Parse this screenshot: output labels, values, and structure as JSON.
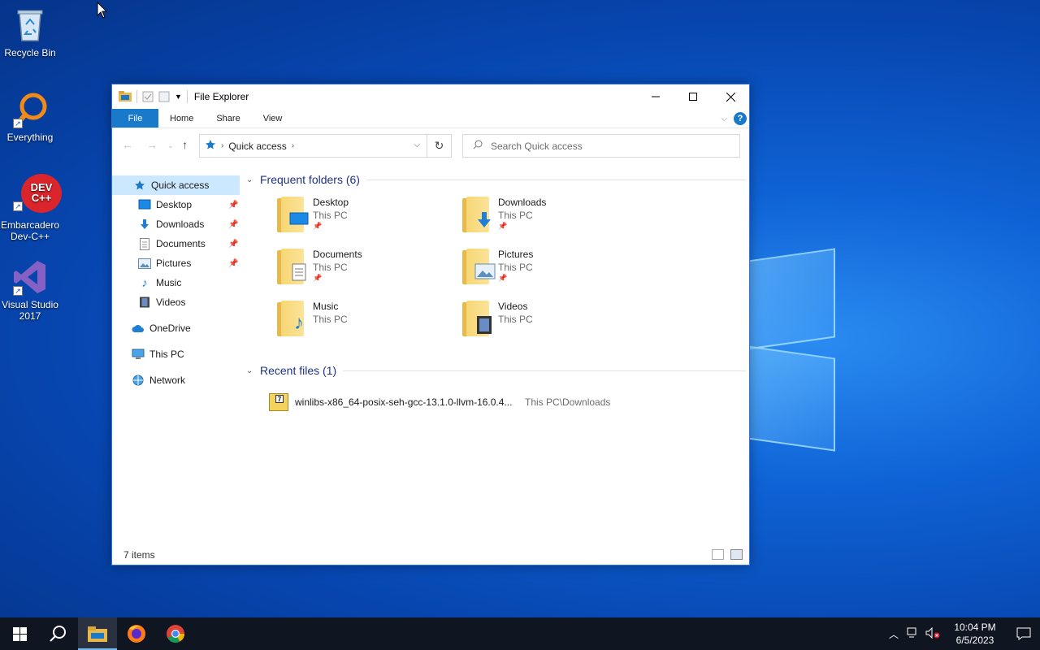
{
  "desktop": {
    "icons": [
      {
        "label": "Recycle Bin"
      },
      {
        "label": "Everything"
      },
      {
        "label": "Embarcadero Dev-C++",
        "logo_text": "DEV C++"
      },
      {
        "label": "Visual Studio 2017"
      }
    ]
  },
  "window": {
    "title": "File Explorer",
    "ribbon_tabs": [
      "File",
      "Home",
      "Share",
      "View"
    ],
    "help_label": "?",
    "address": {
      "crumb": "Quick access"
    },
    "search": {
      "placeholder": "Search Quick access"
    },
    "sidebar": {
      "quick_access": "Quick access",
      "pinned": [
        {
          "label": "Desktop",
          "icon": "desktop-icon"
        },
        {
          "label": "Downloads",
          "icon": "download-arrow-icon"
        },
        {
          "label": "Documents",
          "icon": "document-icon"
        },
        {
          "label": "Pictures",
          "icon": "picture-icon"
        },
        {
          "label": "Music",
          "icon": "music-note-icon"
        },
        {
          "label": "Videos",
          "icon": "film-icon"
        }
      ],
      "onedrive": "OneDrive",
      "this_pc": "This PC",
      "network": "Network"
    },
    "frequent": {
      "header": "Frequent folders (6)",
      "folders": [
        {
          "name": "Desktop",
          "location": "This PC",
          "pinned": true
        },
        {
          "name": "Downloads",
          "location": "This PC",
          "pinned": true
        },
        {
          "name": "Documents",
          "location": "This PC",
          "pinned": true
        },
        {
          "name": "Pictures",
          "location": "This PC",
          "pinned": true
        },
        {
          "name": "Music",
          "location": "This PC",
          "pinned": false
        },
        {
          "name": "Videos",
          "location": "This PC",
          "pinned": false
        }
      ]
    },
    "recent": {
      "header": "Recent files (1)",
      "files": [
        {
          "name": "winlibs-x86_64-posix-seh-gcc-13.1.0-llvm-16.0.4...",
          "path": "This PC\\Downloads"
        }
      ]
    },
    "status": "7 items"
  },
  "taskbar": {
    "time": "10:04 PM",
    "date": "6/5/2023",
    "active_app": "File Explorer"
  },
  "colors": {
    "accent": "#1979ca",
    "selection": "#cce8ff",
    "group_header": "#1e3287",
    "taskbar": "#101522"
  }
}
